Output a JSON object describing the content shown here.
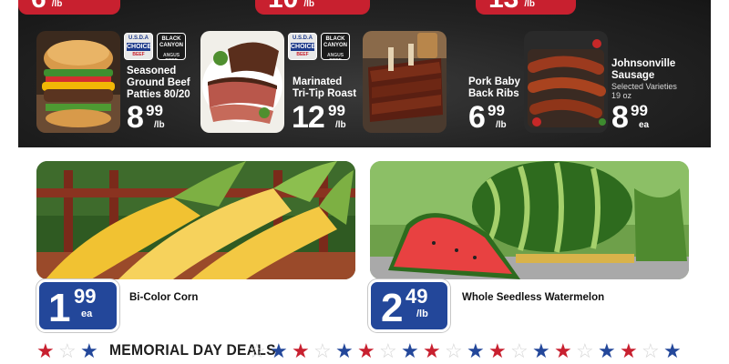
{
  "top_prices": [
    {
      "whole": "6",
      "unit": "/lb"
    },
    {
      "whole": "10",
      "unit": "/lb"
    },
    {
      "whole": "13",
      "unit": "/lb"
    }
  ],
  "badges": {
    "usda": {
      "line1": "U.S.D.A",
      "line2": "CHOICE",
      "line3": "BEEF"
    },
    "black_canyon": {
      "line1": "BLACK CANYON",
      "line2": "ANGUS BEEF"
    }
  },
  "meat_items": [
    {
      "name": "Seasoned\nGround Beef\nPatties 80/20",
      "whole": "8",
      "cents": "99",
      "unit": "/lb"
    },
    {
      "name": "Marinated\nTri-Tip Roast",
      "whole": "12",
      "cents": "99",
      "unit": "/lb"
    },
    {
      "name": "Pork Baby\nBack Ribs",
      "whole": "6",
      "cents": "99",
      "unit": "/lb"
    },
    {
      "name": "Johnsonville\nSausage",
      "sub": "Selected Varieties\n19 oz",
      "whole": "8",
      "cents": "99",
      "unit": "ea"
    }
  ],
  "produce_items": [
    {
      "name": "Bi-Color Corn",
      "whole": "1",
      "cents": "99",
      "unit": "ea"
    },
    {
      "name": "Whole Seedless Watermelon",
      "whole": "2",
      "cents": "49",
      "unit": "/lb"
    }
  ],
  "banner": {
    "title": "MEMORIAL DAY DEALS"
  },
  "colors": {
    "red": "#c8202f",
    "blue": "#23479a",
    "dark": "#232323"
  }
}
